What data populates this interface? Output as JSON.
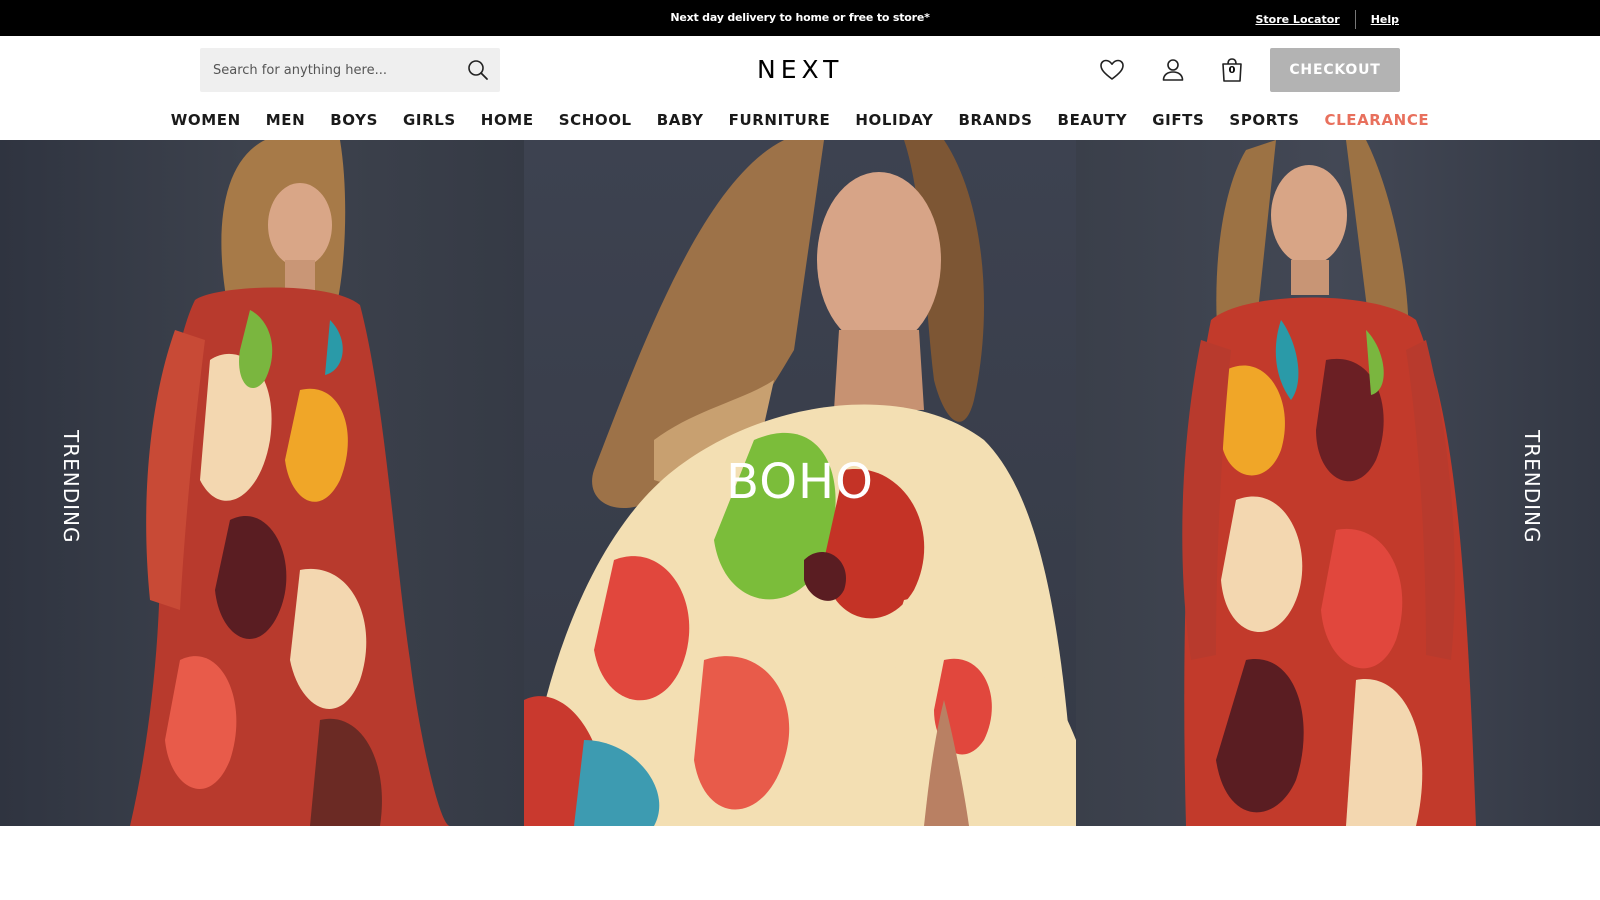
{
  "promo": {
    "message": "Next day delivery to home or free to store*",
    "store_locator": "Store Locator",
    "help": "Help"
  },
  "header": {
    "search_placeholder": "Search for anything here...",
    "logo": "NEXT",
    "bag_count": "0",
    "checkout_label": "CHECKOUT"
  },
  "nav": {
    "items": [
      {
        "label": "WOMEN"
      },
      {
        "label": "MEN"
      },
      {
        "label": "BOYS"
      },
      {
        "label": "GIRLS"
      },
      {
        "label": "HOME"
      },
      {
        "label": "SCHOOL"
      },
      {
        "label": "BABY"
      },
      {
        "label": "FURNITURE"
      },
      {
        "label": "HOLIDAY"
      },
      {
        "label": "BRANDS"
      },
      {
        "label": "BEAUTY"
      },
      {
        "label": "GIFTS"
      },
      {
        "label": "SPORTS"
      },
      {
        "label": "CLEARANCE"
      }
    ]
  },
  "hero": {
    "title": "BOHO",
    "left_label": "TRENDING",
    "right_label": "TRENDING"
  },
  "colors": {
    "promo_bg": "#000000",
    "checkout_bg": "#b3b3b3",
    "clearance": "#e8705d",
    "hero_bg": "#3a3e48"
  }
}
